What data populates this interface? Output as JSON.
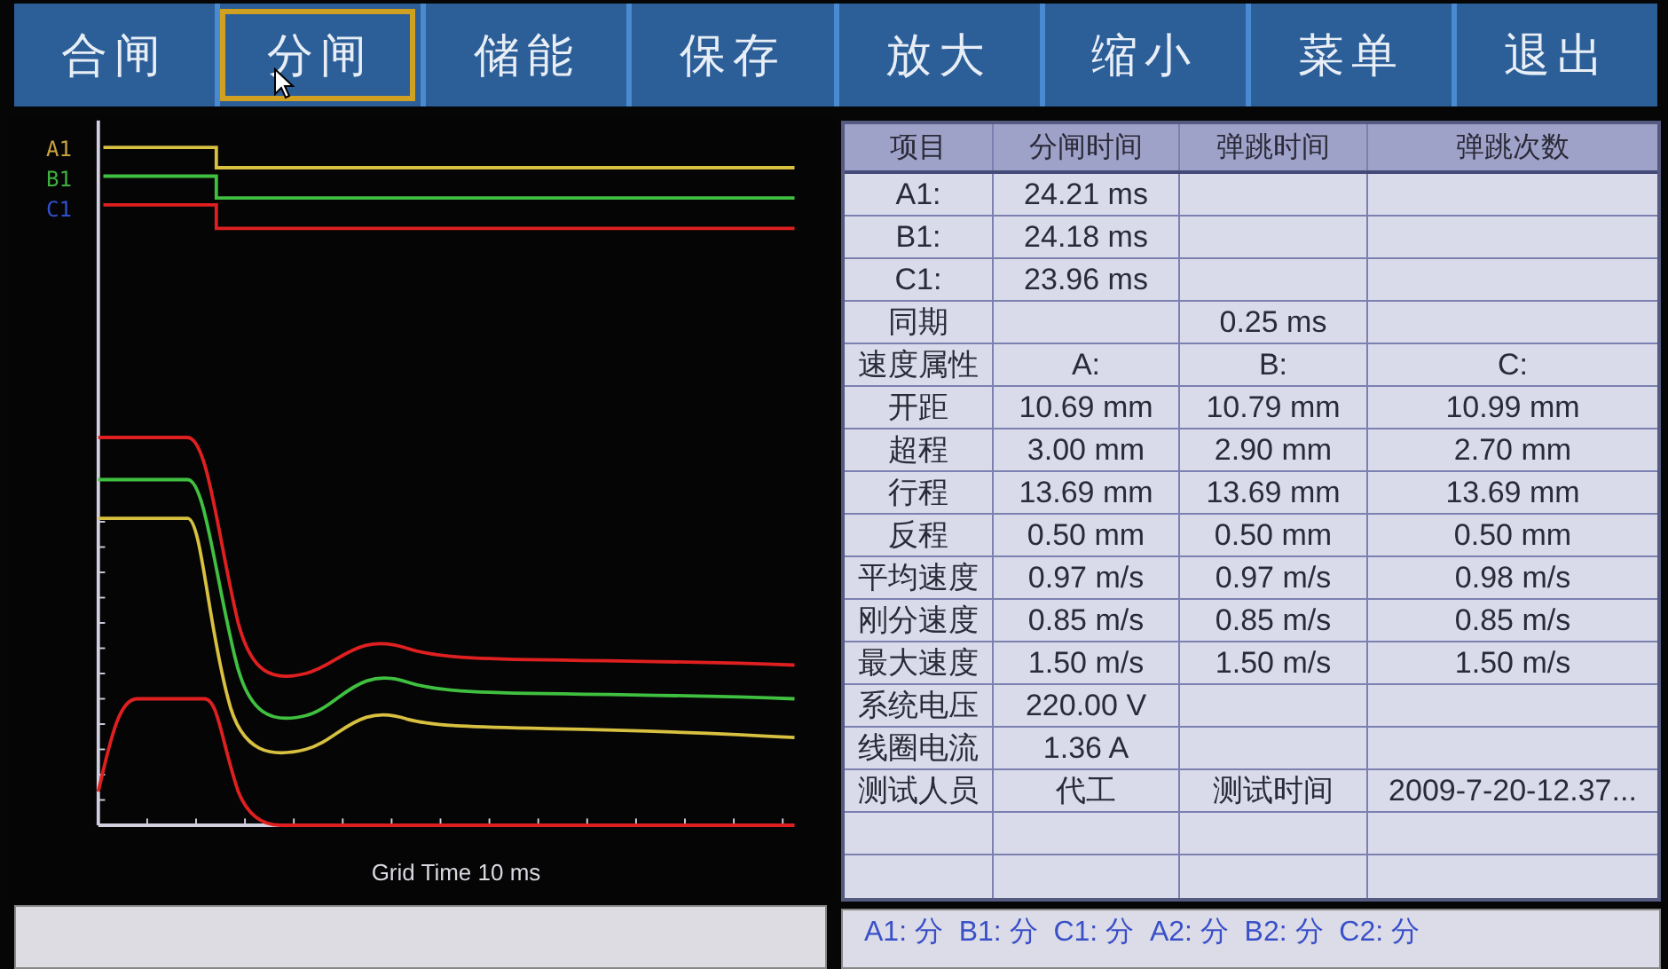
{
  "menu": [
    {
      "label": "合闸",
      "selected": false
    },
    {
      "label": "分闸",
      "selected": true
    },
    {
      "label": "储能",
      "selected": false
    },
    {
      "label": "保存",
      "selected": false
    },
    {
      "label": "放大",
      "selected": false
    },
    {
      "label": "缩小",
      "selected": false
    },
    {
      "label": "菜单",
      "selected": false
    },
    {
      "label": "退出",
      "selected": false
    }
  ],
  "waveform": {
    "legend": [
      {
        "label": "A1",
        "color": "#c8a040"
      },
      {
        "label": "B1",
        "color": "#40b040"
      },
      {
        "label": "C1",
        "color": "#3050d0"
      }
    ],
    "grid_label": "Grid Time   10  ms"
  },
  "table": {
    "columns": [
      "项目",
      "分闸时间",
      "弹跳时间",
      "弹跳次数"
    ],
    "rows": [
      [
        "A1:",
        "24.21 ms",
        null,
        null
      ],
      [
        "B1:",
        "24.18 ms",
        null,
        null
      ],
      [
        "C1:",
        "23.96 ms",
        null,
        null
      ],
      [
        "同期",
        null,
        "0.25 ms",
        null
      ],
      [
        "速度属性",
        "A:",
        "B:",
        "C:"
      ],
      [
        "开距",
        "10.69 mm",
        "10.79 mm",
        "10.99 mm"
      ],
      [
        "超程",
        "3.00 mm",
        "2.90 mm",
        "2.70 mm"
      ],
      [
        "行程",
        "13.69 mm",
        "13.69 mm",
        "13.69 mm"
      ],
      [
        "反程",
        "0.50 mm",
        "0.50 mm",
        "0.50 mm"
      ],
      [
        "平均速度",
        "0.97 m/s",
        "0.97 m/s",
        "0.98 m/s"
      ],
      [
        "刚分速度",
        "0.85 m/s",
        "0.85 m/s",
        "0.85 m/s"
      ],
      [
        "最大速度",
        "1.50 m/s",
        "1.50 m/s",
        "1.50 m/s"
      ],
      [
        "系统电压",
        "220.00 V",
        null,
        null
      ],
      [
        "线圈电流",
        "1.36 A",
        null,
        null
      ],
      [
        "测试人员",
        "代工",
        "测试时间",
        "2009-7-20-12.37..."
      ]
    ]
  },
  "status_line": "A1: 分  B1: 分  C1: 分  A2: 分  B2: 分  C2: 分"
}
